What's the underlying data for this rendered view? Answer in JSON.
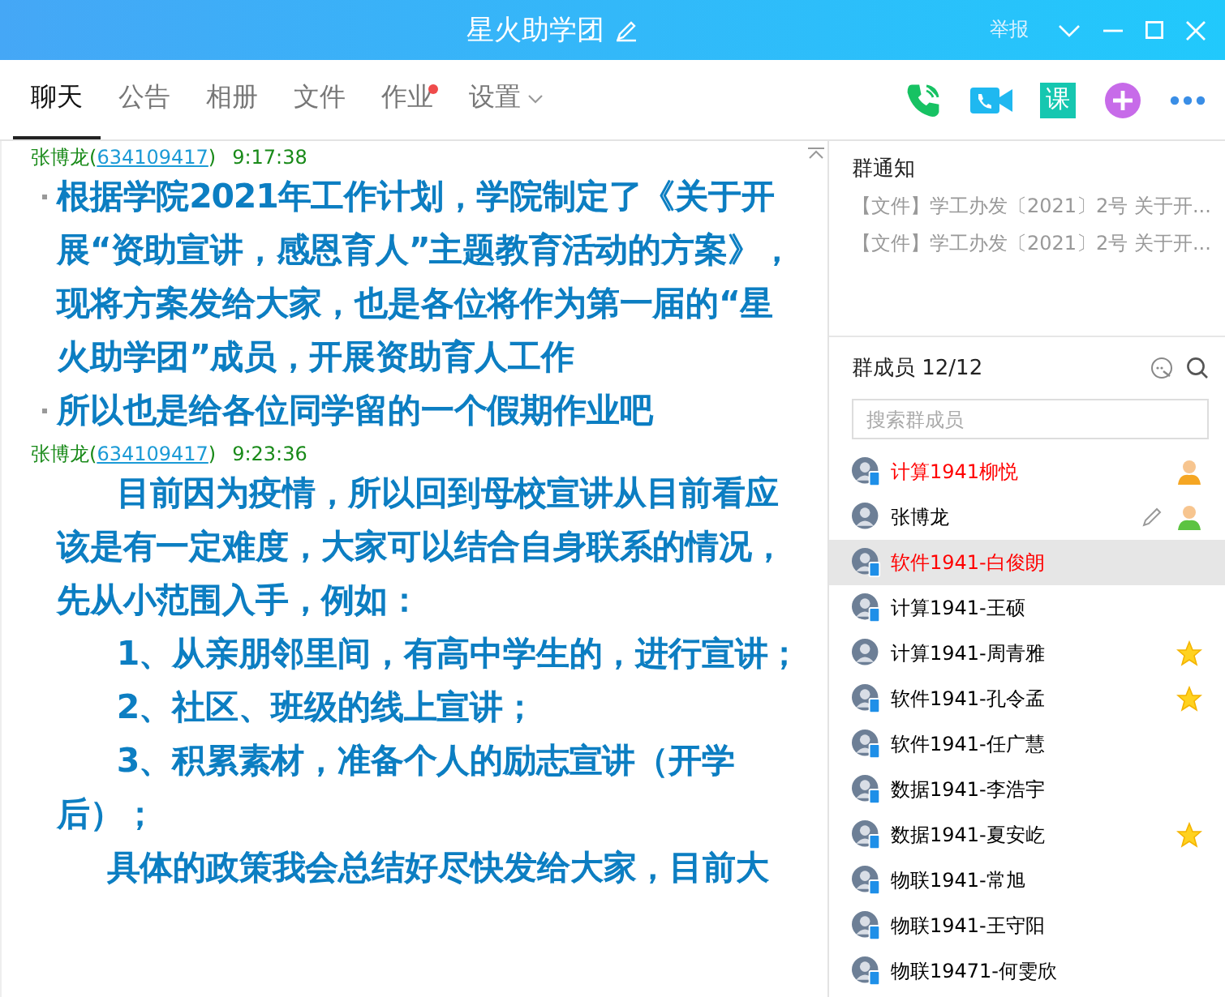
{
  "window": {
    "title": "星火助学团",
    "report": "举报"
  },
  "tabs": [
    {
      "label": "聊天",
      "selected": true,
      "dot": false,
      "menu": false
    },
    {
      "label": "公告",
      "selected": false,
      "dot": false,
      "menu": false
    },
    {
      "label": "相册",
      "selected": false,
      "dot": false,
      "menu": false
    },
    {
      "label": "文件",
      "selected": false,
      "dot": false,
      "menu": false
    },
    {
      "label": "作业",
      "selected": false,
      "dot": true,
      "menu": false
    },
    {
      "label": "设置",
      "selected": false,
      "dot": false,
      "menu": true
    }
  ],
  "toolbar": [
    {
      "kind": "call"
    },
    {
      "kind": "video"
    },
    {
      "kind": "lesson",
      "label": "课"
    },
    {
      "kind": "add"
    },
    {
      "kind": "more"
    }
  ],
  "messages": [
    {
      "sender": "张博龙",
      "id": "(634109417)",
      "time": "9:17:38",
      "paragraphs": [
        {
          "kind": "bullet",
          "text": "根据学院2021年工作计划，学院制定了《关于开展“资助宣讲，感恩育人”主题教育活动的方案》，现将方案发给大家，也是各位将作为第一届的“星火助学团”成员，开展资助育人工作"
        },
        {
          "kind": "bullet",
          "text": "所以也是给各位同学留的一个假期作业吧"
        }
      ]
    },
    {
      "sender": "张博龙",
      "id": "(634109417)",
      "time": "9:23:36",
      "paragraphs": [
        {
          "kind": "indent",
          "text": "目前因为疫情，所以回到母校宣讲从目前看应该是有一定难度，大家可以结合自身联系的情况，先从小范围入手，例如："
        },
        {
          "kind": "indent",
          "text": "1、从亲朋邻里间，有高中学生的，进行宣讲；"
        },
        {
          "kind": "indent",
          "text": "2、社区、班级的线上宣讲；"
        },
        {
          "kind": "indent",
          "text": "3、积累素材，准备个人的励志宣讲（开学后）；"
        },
        {
          "kind": "partial",
          "text": "具体的政策我会总结好尽快发给大家，目前大"
        }
      ]
    }
  ],
  "notices": {
    "title": "群通知",
    "items": [
      "【文件】学工办发〔2021〕2号 关于开...",
      "【文件】学工办发〔2021〕2号 关于开..."
    ]
  },
  "members": {
    "title": "群成员 12/12",
    "search": {
      "placeholder": "搜索群成员"
    },
    "items": [
      {
        "name": "计算1941柳悦",
        "color": "#ff0000",
        "selected": false,
        "mobile": true,
        "kind": "owner",
        "editable": false
      },
      {
        "name": "张博龙",
        "color": "#000000",
        "selected": false,
        "mobile": false,
        "kind": "admin",
        "editable": true
      },
      {
        "name": "软件1941-白俊朗",
        "color": "#ff0000",
        "selected": true,
        "mobile": true,
        "kind": "member",
        "editable": false
      },
      {
        "name": "计算1941-王硕",
        "color": "#000000",
        "selected": false,
        "mobile": true,
        "kind": "member",
        "editable": false
      },
      {
        "name": "计算1941-周青雅",
        "color": "#000000",
        "selected": false,
        "mobile": false,
        "kind": "star",
        "editable": false
      },
      {
        "name": "软件1941-孔令孟",
        "color": "#000000",
        "selected": false,
        "mobile": true,
        "kind": "star",
        "editable": false
      },
      {
        "name": "软件1941-任广慧",
        "color": "#000000",
        "selected": false,
        "mobile": true,
        "kind": "member",
        "editable": false
      },
      {
        "name": "数据1941-李浩宇",
        "color": "#000000",
        "selected": false,
        "mobile": true,
        "kind": "member",
        "editable": false
      },
      {
        "name": "数据1941-夏安屹",
        "color": "#000000",
        "selected": false,
        "mobile": true,
        "kind": "star",
        "editable": false
      },
      {
        "name": "物联1941-常旭",
        "color": "#000000",
        "selected": false,
        "mobile": true,
        "kind": "member",
        "editable": false
      },
      {
        "name": "物联1941-王守阳",
        "color": "#000000",
        "selected": false,
        "mobile": true,
        "kind": "member",
        "editable": false
      },
      {
        "name": "物联19471-何雯欣",
        "color": "#000000",
        "selected": false,
        "mobile": true,
        "kind": "member",
        "editable": false
      }
    ]
  }
}
